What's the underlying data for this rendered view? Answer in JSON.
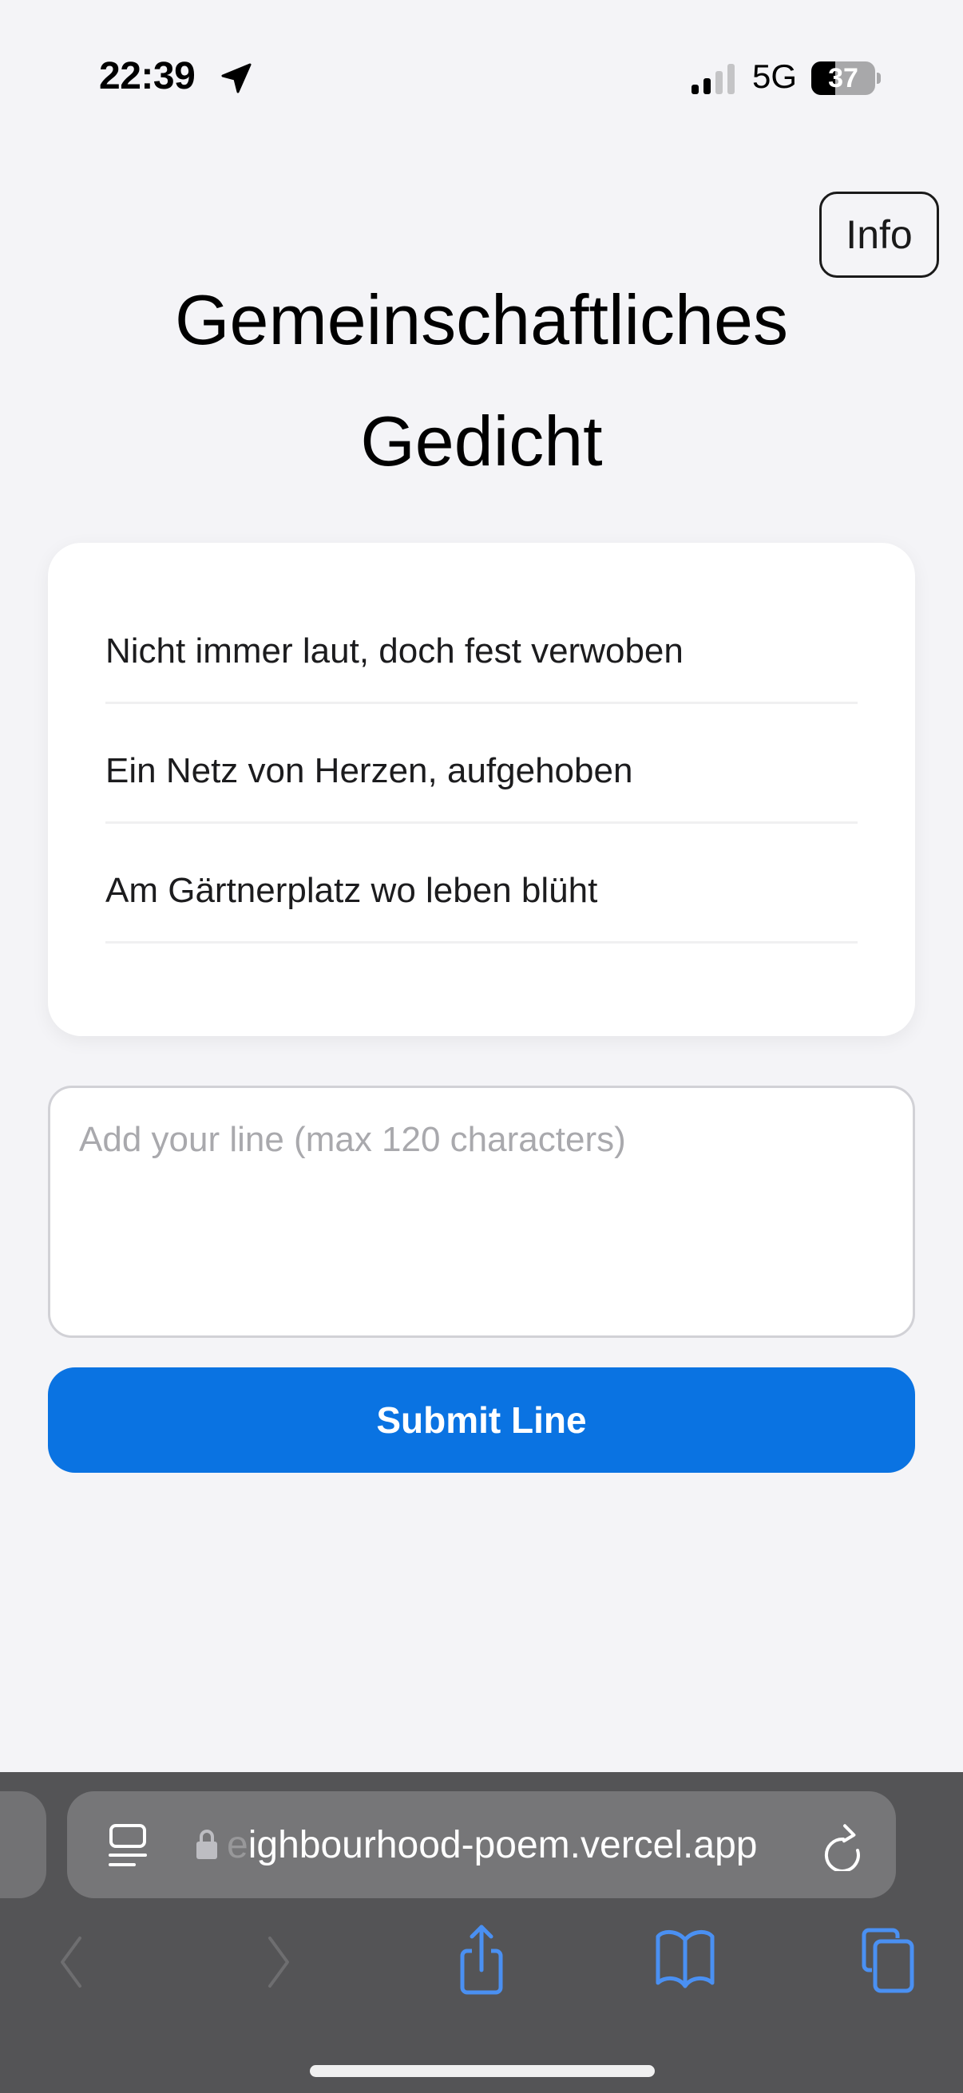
{
  "status_bar": {
    "time": "22:39",
    "location_icon": "location-arrow-icon",
    "signal_icon": "cellular-signal-icon",
    "signal_bars_active": 2,
    "signal_bars_total": 4,
    "network": "5G",
    "battery_percent": 37,
    "battery_label": "37"
  },
  "header": {
    "info_button_label": "Info",
    "title": "Gemeinschaftliches Gedicht"
  },
  "poem": {
    "lines": [
      "Nicht immer laut, doch fest verwoben",
      "Ein Netz von Herzen, aufgehoben",
      "Am Gärtnerplatz wo leben blüht"
    ]
  },
  "composer": {
    "input_value": "",
    "input_placeholder": "Add your line (max 120 characters)",
    "max_length": 120,
    "submit_label": "Submit Line",
    "accent_color": "#0A73E2"
  },
  "browser": {
    "url_faded_prefix": "e",
    "url_visible": "ighbourhood-poem.vercel.app",
    "icons": {
      "reader": "reader-mode-icon",
      "lock": "lock-icon",
      "reload": "reload-icon",
      "back": "chevron-left-icon",
      "forward": "chevron-right-icon",
      "share": "share-icon",
      "bookmarks": "bookmarks-book-icon",
      "tabs": "tabs-icon"
    },
    "icon_color": "#4A90F2"
  }
}
